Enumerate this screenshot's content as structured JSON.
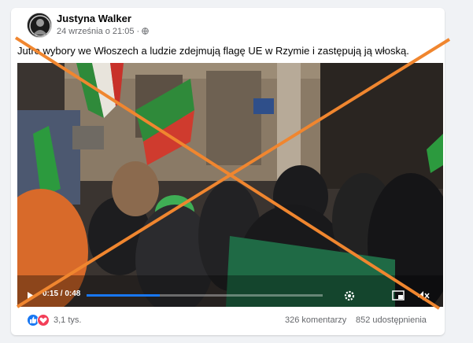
{
  "post": {
    "author": "Justyna Walker",
    "date": "24 września o 21:05",
    "privacy_icon": "globe-icon",
    "caption": "Jutro wybory we Włoszech a ludzie zdejmują flagę UE w Rzymie i zastępują ją włoską."
  },
  "video": {
    "time_label": "0:15 / 0:48",
    "progress": 0.31,
    "controls": {
      "play": "play-icon",
      "settings": "gear-icon",
      "pip": "picture-in-picture-icon",
      "mute": "mute-icon"
    }
  },
  "stats": {
    "reaction_count": "3,1 tys.",
    "comments": "326 komentarzy",
    "shares": "852 udostępnienia"
  },
  "colors": {
    "x_overlay": "#f0862f",
    "facebook_blue": "#1877f2",
    "love_red": "#f33e58"
  }
}
